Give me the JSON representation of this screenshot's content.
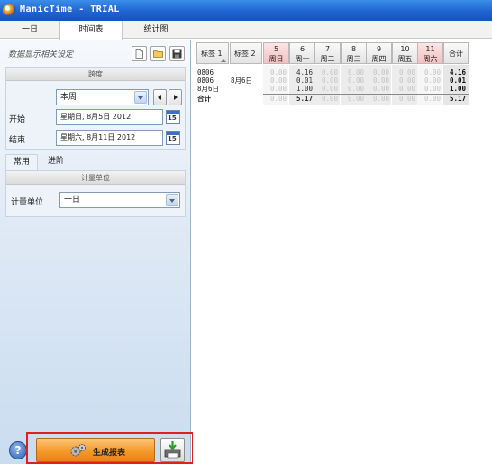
{
  "window": {
    "title": "ManicTime - TRIAL"
  },
  "main_tabs": [
    "一日",
    "时间表",
    "统计图"
  ],
  "left_panel": {
    "caption": "数据显示相关设定",
    "range_group": {
      "title": "跨度",
      "period_value": "本周",
      "start_label": "开始",
      "start_value": "星期日, 8月5日 2012",
      "end_label": "结束",
      "end_value": "星期六, 8月11日 2012",
      "calendar_day": "15"
    },
    "sub_tabs": [
      "常用",
      "进阶"
    ],
    "unit_group": {
      "title": "计量单位",
      "unit_label": "计量单位",
      "unit_value": "一日"
    },
    "help_label": "?",
    "generate_label": "生成报表"
  },
  "grid": {
    "tag_columns": [
      "标签 1",
      "标签 2"
    ],
    "day_columns": [
      {
        "num": "5",
        "day": "周日"
      },
      {
        "num": "6",
        "day": "周一"
      },
      {
        "num": "7",
        "day": "周二"
      },
      {
        "num": "8",
        "day": "周三"
      },
      {
        "num": "9",
        "day": "周四"
      },
      {
        "num": "10",
        "day": "周五"
      },
      {
        "num": "11",
        "day": "周六"
      }
    ],
    "total_header": "合计",
    "rows": [
      {
        "tag1": "0806",
        "tag2": "",
        "values": [
          "0.00",
          "4.16",
          "0.00",
          "0.00",
          "0.00",
          "0.00",
          "0.00"
        ],
        "total": "4.16"
      },
      {
        "tag1": "0806",
        "tag2": "8月6日",
        "values": [
          "0.00",
          "0.01",
          "0.00",
          "0.00",
          "0.00",
          "0.00",
          "0.00"
        ],
        "total": "0.01"
      },
      {
        "tag1": "8月6日",
        "tag2": "",
        "values": [
          "0.00",
          "1.00",
          "0.00",
          "0.00",
          "0.00",
          "0.00",
          "0.00"
        ],
        "total": "1.00"
      }
    ],
    "total_row": {
      "label": "合计",
      "values": [
        "0.00",
        "5.17",
        "0.00",
        "0.00",
        "0.00",
        "0.00",
        "0.00"
      ],
      "total": "5.17"
    }
  }
}
